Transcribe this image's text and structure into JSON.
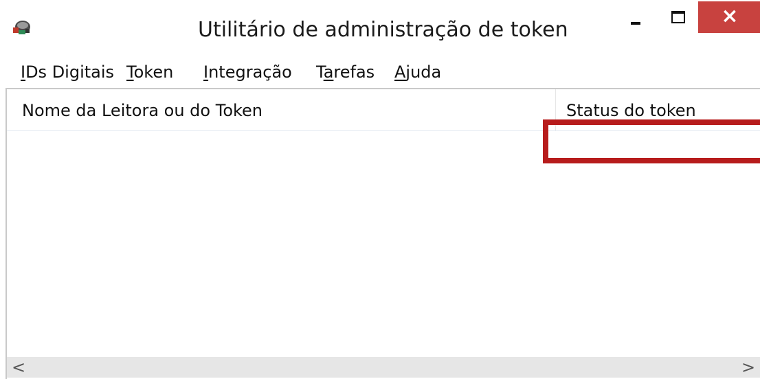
{
  "window": {
    "title": "Utilitário de administração de token",
    "close_glyph": "×"
  },
  "menu": {
    "items": [
      {
        "pre": "",
        "key": "I",
        "post": "Ds Digitais"
      },
      {
        "pre": "",
        "key": "T",
        "post": "oken"
      },
      {
        "pre": "",
        "key": "I",
        "post": "ntegração"
      },
      {
        "pre": "T",
        "key": "a",
        "post": "refas"
      },
      {
        "pre": "",
        "key": "A",
        "post": "juda"
      }
    ]
  },
  "list": {
    "columns": [
      "Nome da Leitora ou do Token",
      "Status do token"
    ]
  },
  "scrollbar": {
    "left_glyph": "<",
    "right_glyph": ">"
  },
  "colors": {
    "close_button": "#c8423f",
    "highlight_box": "#b71c1c"
  },
  "icons": {
    "app": "token-reader-icon"
  }
}
